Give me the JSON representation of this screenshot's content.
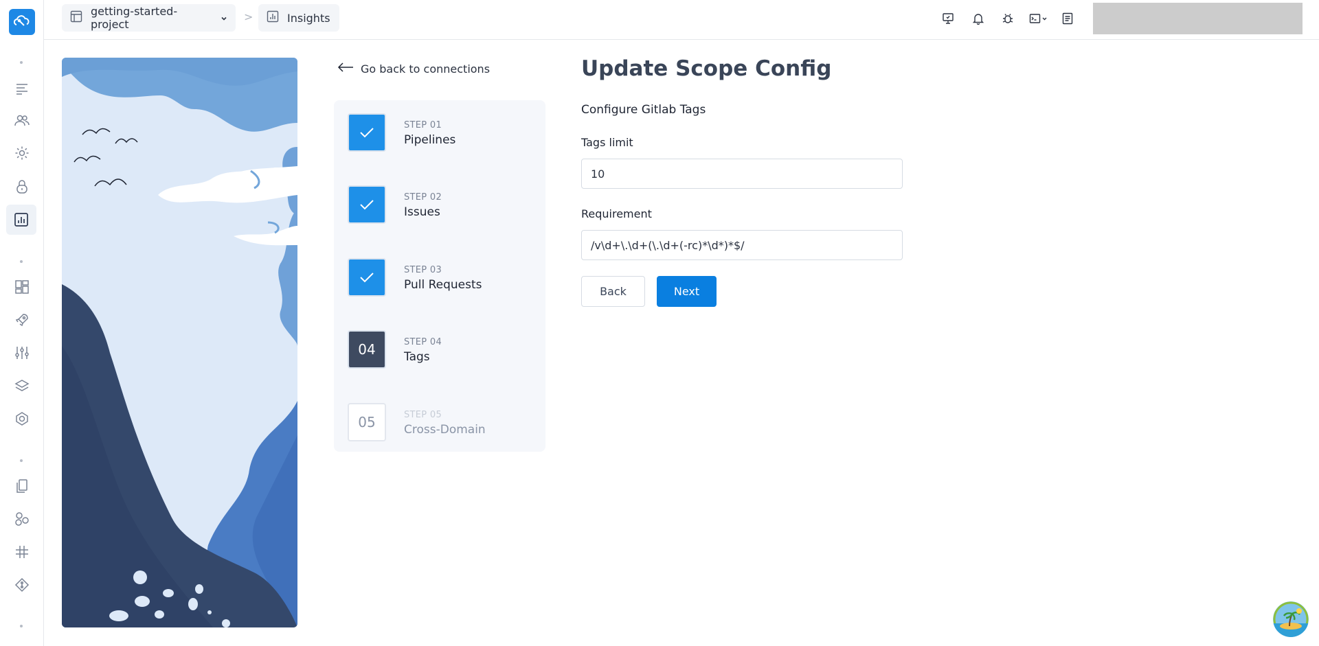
{
  "breadcrumb": {
    "project": "getting-started-project",
    "separator": ">",
    "page": "Insights"
  },
  "back_link": "Go back to connections",
  "steps": [
    {
      "number_label": "STEP 01",
      "name": "Pipelines",
      "status": "done"
    },
    {
      "number_label": "STEP 02",
      "name": "Issues",
      "status": "done"
    },
    {
      "number_label": "STEP 03",
      "name": "Pull Requests",
      "status": "done"
    },
    {
      "number_label": "STEP 04",
      "name": "Tags",
      "status": "current",
      "badge": "04"
    },
    {
      "number_label": "STEP 05",
      "name": "Cross-Domain",
      "status": "pending",
      "badge": "05"
    }
  ],
  "form": {
    "title": "Update Scope Config",
    "section": "Configure Gitlab Tags",
    "tags_limit_label": "Tags limit",
    "tags_limit_value": "10",
    "requirement_label": "Requirement",
    "requirement_value": "/v\\d+\\.\\d+(\\.\\d+(-rc)*\\d*)*$/",
    "back_button": "Back",
    "next_button": "Next"
  },
  "colors": {
    "brand": "#1e88e5",
    "primary_button": "#0a7fe0",
    "step_done": "#1e90e8",
    "step_current": "#3e4a60"
  }
}
